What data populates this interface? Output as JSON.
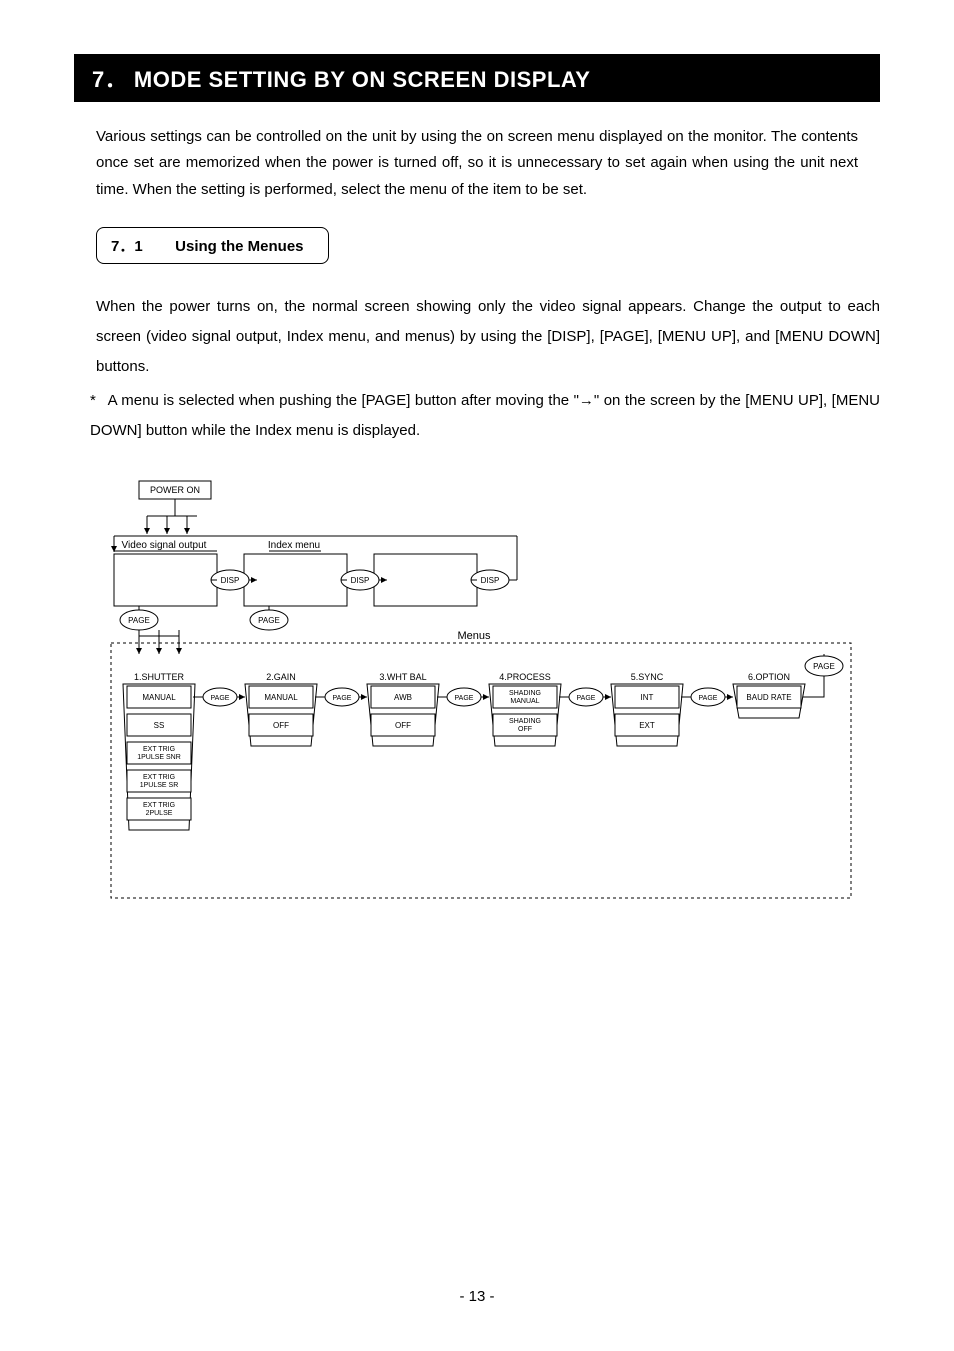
{
  "header": {
    "section_num": "7．",
    "section_title": "MODE SETTING BY ON SCREEN DISPLAY"
  },
  "intro_text": "Various settings can be controlled on the unit by using the on screen menu displayed on the monitor. The contents once set are memorized when the power is turned off, so it is unnecessary to set again when using the unit next time. When the setting is performed, select the menu of the item to be set.",
  "subsection": {
    "num": "7．1",
    "title": "Using the Menues"
  },
  "paragraph": "When the power turns on, the normal screen showing only the video signal appears. Change the output to each screen (video signal output, Index menu, and menus) by using the [DISP], [PAGE], [MENU UP], and [MENU DOWN] buttons.",
  "note": {
    "asterisk": "*",
    "line1": "A menu is selected when pushing the [PAGE] button after moving the \"→\" on the screen by the [MENU UP], [MENU DOWN] button while the Index menu is displayed.",
    "line1_part2": ""
  },
  "diagram": {
    "power_on": "POWER ON",
    "video_signal": "Video signal output",
    "index_menu": "Index menu",
    "disp": "DISP",
    "page": "PAGE",
    "menus_label": "Menus",
    "cols": [
      {
        "title": "1.SHUTTER",
        "items": [
          "MANUAL",
          "SS",
          "EXT TRIG 1PULSE SNR",
          "EXT TRIG 1PULSE SR",
          "EXT TRIG 2PULSE"
        ]
      },
      {
        "title": "2.GAIN",
        "items": [
          "MANUAL",
          "OFF"
        ]
      },
      {
        "title": "3.WHT BAL",
        "items": [
          "AWB",
          "OFF"
        ]
      },
      {
        "title": "4.PROCESS",
        "items": [
          "SHADING MANUAL",
          "SHADING OFF"
        ]
      },
      {
        "title": "5.SYNC",
        "items": [
          "INT",
          "EXT"
        ]
      },
      {
        "title": "6.OPTION",
        "items": [
          "BAUD RATE"
        ]
      }
    ]
  },
  "page_number": "- 13 -"
}
